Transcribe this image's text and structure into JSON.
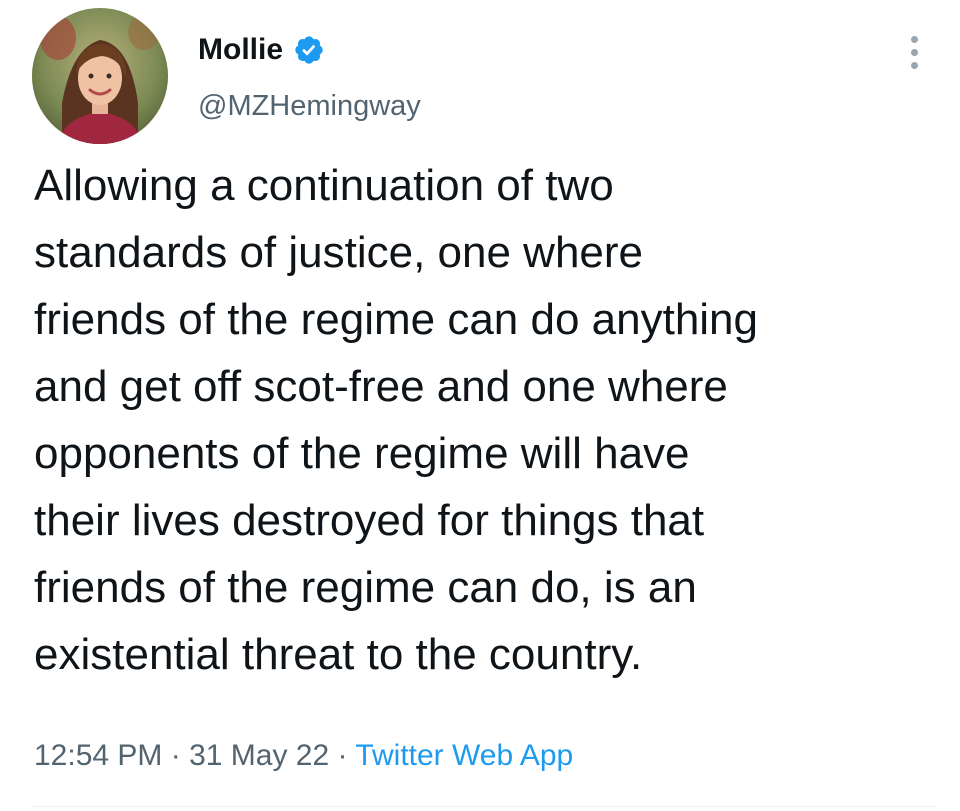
{
  "author": {
    "name": "Mollie",
    "handle": "@MZHemingway",
    "verified": true,
    "verified_color": "#1d9bf0"
  },
  "tweet": {
    "lines": [
      "Allowing a continuation of two",
      "standards of justice, one where",
      "friends of the regime can do anything",
      "and get off scot-free and one where",
      "opponents of the regime will have",
      "their lives destroyed for things that",
      "friends of the regime can do, is an",
      "existential threat to the country."
    ]
  },
  "meta": {
    "time": "12:54 PM",
    "date": "31 May 22",
    "separator": " · ",
    "source": "Twitter Web App",
    "source_color": "#1d9bf0"
  },
  "icons": {
    "more": "more-dots-vertical-icon",
    "verified": "verified-badge-icon"
  }
}
